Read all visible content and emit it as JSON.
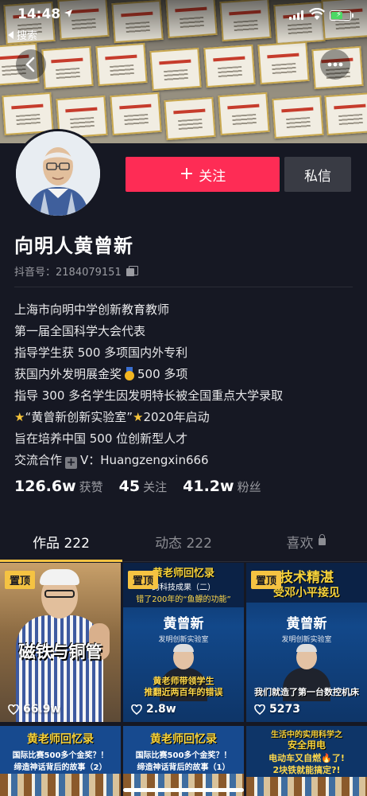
{
  "status_bar": {
    "time": "14:48",
    "back_app": "搜索"
  },
  "profile": {
    "name": "向明人黄曾新",
    "douyin_id": "抖音号：2184079151",
    "follow_label": "关注",
    "message_label": "私信",
    "bio": {
      "line1": "上海市向明中学创新教育教师",
      "line2": "第一届全国科学大会代表",
      "line3": "指导学生获 500 多项国内外专利",
      "line4a": "获国内外发明展金奖",
      "line4b": "500 多项",
      "line5": "指导 300 多名学生因发明特长被全国重点大学录取",
      "line6a": "“黄曾新创新实验室”",
      "line6b": "2020年启动",
      "line7": "旨在培养中国 500 位创新型人才",
      "line8a": "交流合作",
      "line8b": "V：Huangzengxin666"
    },
    "stats": [
      {
        "value": "126.6w",
        "label": "获赞"
      },
      {
        "value": "45",
        "label": "关注"
      },
      {
        "value": "41.2w",
        "label": "粉丝"
      }
    ]
  },
  "tabs": [
    {
      "label": "作品 222",
      "active": true
    },
    {
      "label": "动态 222",
      "active": false
    },
    {
      "label": "喜欢",
      "active": false,
      "locked": true
    }
  ],
  "videos": [
    {
      "pinned_label": "置顶",
      "title": "磁铁与铜管",
      "likes": "66.9w"
    },
    {
      "pinned_label": "置顶",
      "top_title": "黄老师回忆录",
      "top_sub1": "的科技成果（二）",
      "top_sub2": "错了200年的“鱼鳔的功能”",
      "brand": "黄曾新",
      "brand_sub": "发明创新实验室",
      "caption1": "黄老师带领学生",
      "caption2": "推翻近两百年的错误",
      "likes": "2.8w"
    },
    {
      "pinned_label": "置顶",
      "top_title": "技术精湛",
      "top_sub2": "受邓小平接见",
      "brand": "黄曾新",
      "brand_sub": "发明创新实验室",
      "caption1": "我们就造了第一台数控机床",
      "likes": "5273"
    },
    {
      "title": "黄老师回忆录",
      "line1": "国际比赛500多个金奖？！",
      "line2": "缔造神话背后的故事（2）"
    },
    {
      "title": "黄老师回忆录",
      "line1": "国际比赛500多个金奖？！",
      "line2": "缔造神话背后的故事（1）"
    },
    {
      "title": "生活中的实用科学之",
      "line1": "安全用电",
      "line2": "电动车又自燃🔥了!",
      "line3": "2块铁就能搞定?!"
    }
  ],
  "colors": {
    "accent": "#fe2c55",
    "tab_underline": "#f5c342",
    "background": "#161823"
  }
}
